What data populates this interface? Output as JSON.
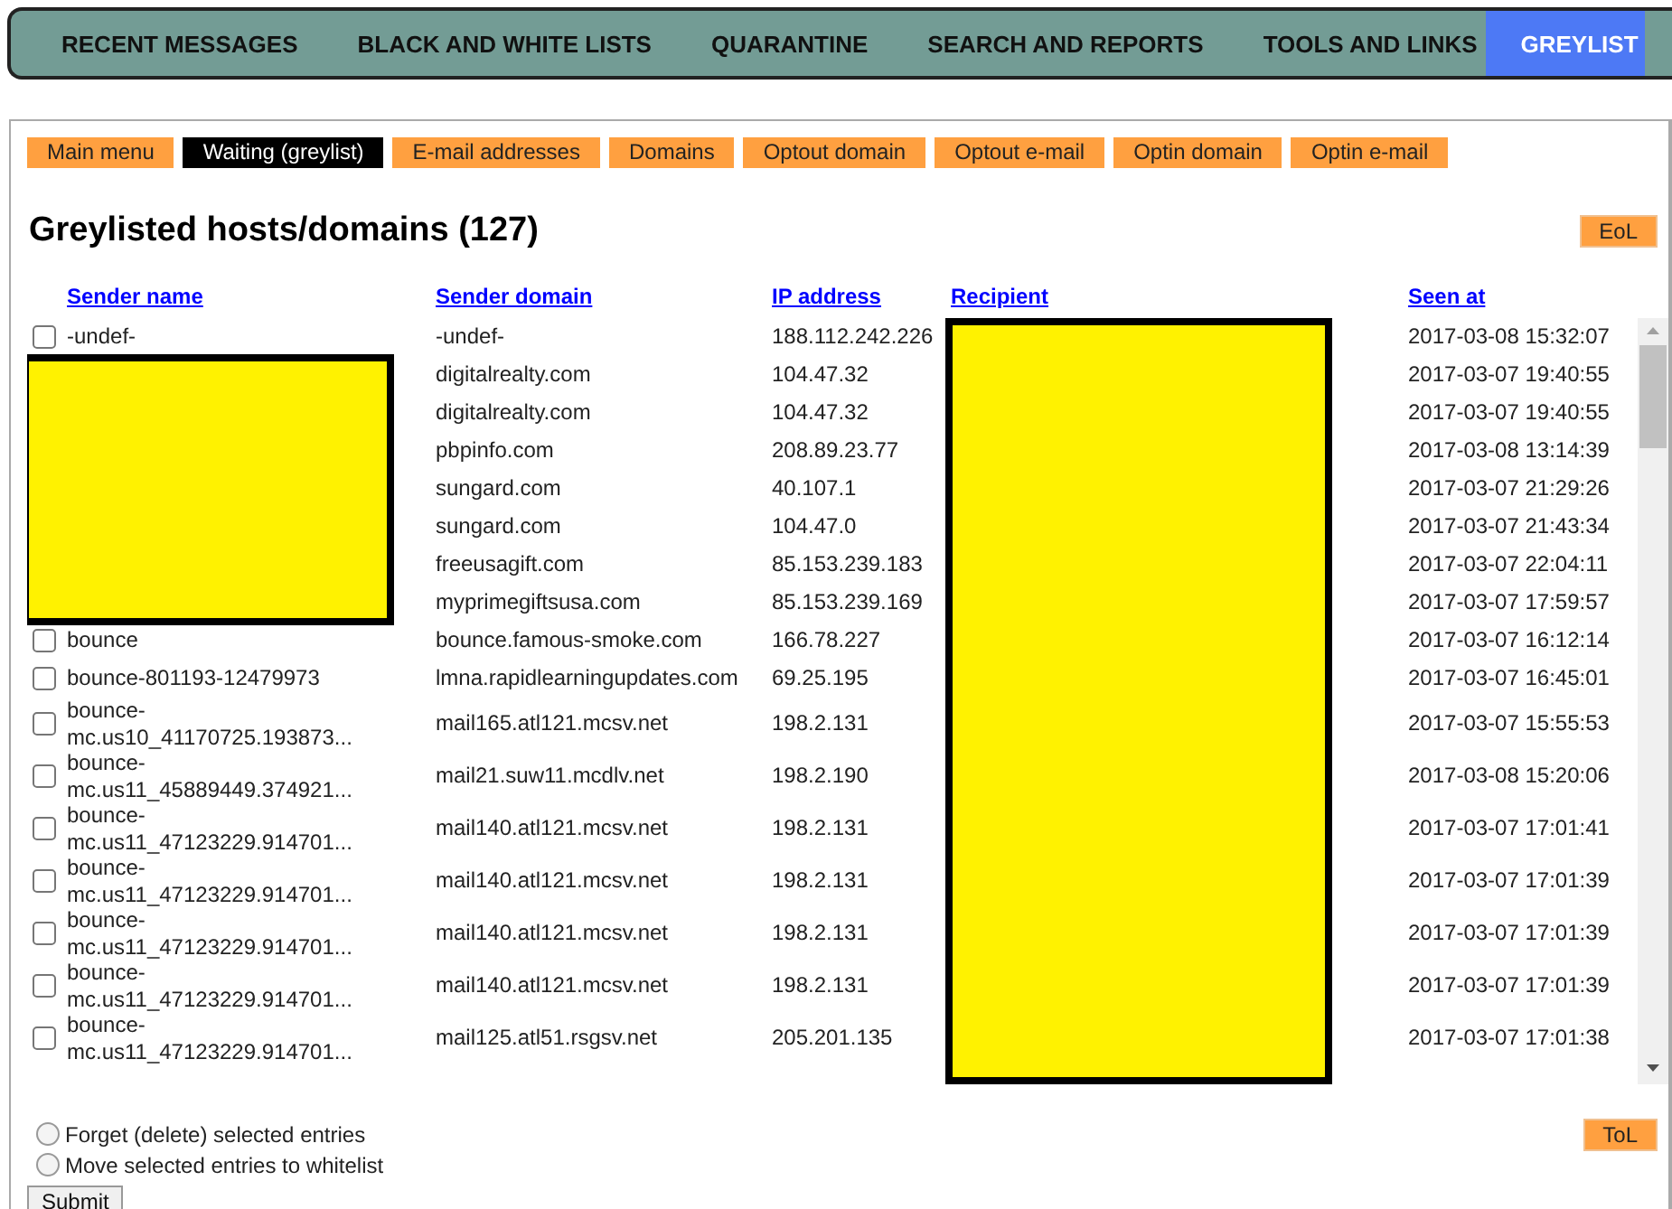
{
  "nav": {
    "items": [
      {
        "label": "RECENT MESSAGES",
        "selected": false
      },
      {
        "label": "BLACK AND WHITE LISTS",
        "selected": false
      },
      {
        "label": "QUARANTINE",
        "selected": false
      },
      {
        "label": "SEARCH AND REPORTS",
        "selected": false
      },
      {
        "label": "TOOLS AND LINKS",
        "selected": false
      },
      {
        "label": "GREYLIST",
        "selected": true
      }
    ]
  },
  "submenu": [
    {
      "label": "Main menu",
      "selected": false
    },
    {
      "label": "Waiting (greylist)",
      "selected": true
    },
    {
      "label": "E-mail addresses",
      "selected": false
    },
    {
      "label": "Domains",
      "selected": false
    },
    {
      "label": "Optout domain",
      "selected": false
    },
    {
      "label": "Optout e-mail",
      "selected": false
    },
    {
      "label": "Optin domain",
      "selected": false
    },
    {
      "label": "Optin e-mail",
      "selected": false
    }
  ],
  "heading": "Greylisted hosts/domains (127)",
  "eol_button": "EoL",
  "table": {
    "columns": [
      "Sender name",
      "Sender domain",
      "IP address",
      "Recipient",
      "Seen at"
    ],
    "rows": [
      {
        "sender_name": "-undef-",
        "checked": false,
        "sender_domain": "-undef-",
        "ip": "188.112.242.226",
        "seen_at": "2017-03-08 15:32:07"
      },
      {
        "sender_domain": "digitalrealty.com",
        "ip": "104.47.32",
        "seen_at": "2017-03-07 19:40:55"
      },
      {
        "sender_domain": "digitalrealty.com",
        "ip": "104.47.32",
        "seen_at": "2017-03-07 19:40:55"
      },
      {
        "sender_domain": "pbpinfo.com",
        "ip": "208.89.23.77",
        "seen_at": "2017-03-08 13:14:39"
      },
      {
        "sender_domain": "sungard.com",
        "ip": "40.107.1",
        "seen_at": "2017-03-07 21:29:26"
      },
      {
        "sender_domain": "sungard.com",
        "ip": "104.47.0",
        "seen_at": "2017-03-07 21:43:34"
      },
      {
        "sender_domain": "freeusagift.com",
        "ip": "85.153.239.183",
        "seen_at": "2017-03-07 22:04:11"
      },
      {
        "sender_domain": "myprimegiftsusa.com",
        "ip": "85.153.239.169",
        "seen_at": "2017-03-07 17:59:57"
      },
      {
        "sender_name": "bounce",
        "checked": false,
        "sender_domain": "bounce.famous-smoke.com",
        "ip": "166.78.227",
        "seen_at": "2017-03-07 16:12:14"
      },
      {
        "sender_name": "bounce-801193-12479973",
        "checked": false,
        "sender_domain": "lmna.rapidlearningupdates.com",
        "ip": "69.25.195",
        "seen_at": "2017-03-07 16:45:01"
      },
      {
        "sender_name": "bounce-mc.us10_41170725.193873...",
        "checked": false,
        "sender_domain": "mail165.atl121.mcsv.net",
        "ip": "198.2.131",
        "seen_at": "2017-03-07 15:55:53"
      },
      {
        "sender_name": "bounce-mc.us11_45889449.374921...",
        "checked": false,
        "sender_domain": "mail21.suw11.mcdlv.net",
        "ip": "198.2.190",
        "seen_at": "2017-03-08 15:20:06"
      },
      {
        "sender_name": "bounce-mc.us11_47123229.914701...",
        "checked": false,
        "sender_domain": "mail140.atl121.mcsv.net",
        "ip": "198.2.131",
        "seen_at": "2017-03-07 17:01:41"
      },
      {
        "sender_name": "bounce-mc.us11_47123229.914701...",
        "checked": false,
        "sender_domain": "mail140.atl121.mcsv.net",
        "ip": "198.2.131",
        "seen_at": "2017-03-07 17:01:39"
      },
      {
        "sender_name": "bounce-mc.us11_47123229.914701...",
        "checked": false,
        "sender_domain": "mail140.atl121.mcsv.net",
        "ip": "198.2.131",
        "seen_at": "2017-03-07 17:01:39"
      },
      {
        "sender_name": "bounce-mc.us11_47123229.914701...",
        "checked": false,
        "sender_domain": "mail140.atl121.mcsv.net",
        "ip": "198.2.131",
        "seen_at": "2017-03-07 17:01:39"
      },
      {
        "sender_name": "bounce-mc.us11_47123229.914701...",
        "checked": false,
        "sender_domain": "mail125.atl51.rsgsv.net",
        "ip": "205.201.135",
        "seen_at": "2017-03-07 17:01:38"
      }
    ]
  },
  "actions": [
    {
      "label": "Forget (delete) selected entries",
      "selected": false
    },
    {
      "label": "Move selected entries to whitelist",
      "selected": false
    }
  ],
  "tol_button": "ToL",
  "submit_button": "Submit"
}
